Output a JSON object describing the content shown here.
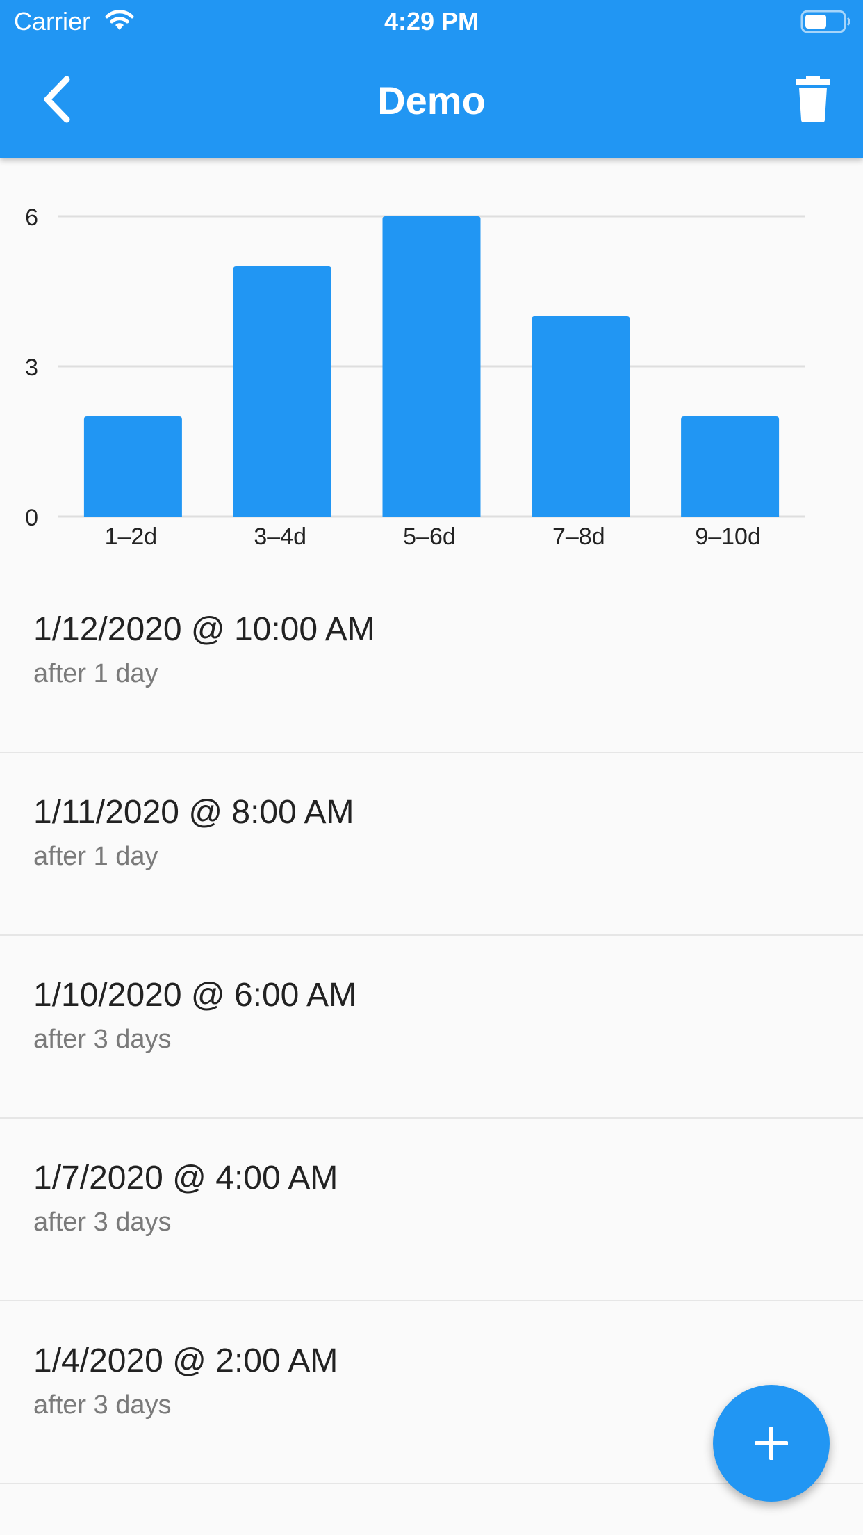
{
  "status_bar": {
    "carrier": "Carrier",
    "time": "4:29 PM"
  },
  "app_bar": {
    "title": "Demo",
    "back_icon": "chevron-left-icon",
    "delete_icon": "trash-icon"
  },
  "colors": {
    "primary": "#2196f3",
    "bar": "#2196f3",
    "background": "#fafafa"
  },
  "chart_data": {
    "type": "bar",
    "categories": [
      "1–2d",
      "3–4d",
      "5–6d",
      "7–8d",
      "9–10d"
    ],
    "values": [
      2,
      5,
      6,
      4,
      2
    ],
    "ylim": [
      0,
      6
    ],
    "yticks": [
      "0",
      "3",
      "6"
    ],
    "grid": true,
    "title": "",
    "xlabel": "",
    "ylabel": ""
  },
  "entries": [
    {
      "datetime": "1/12/2020 @ 10:00 AM",
      "interval": "after 1 day"
    },
    {
      "datetime": "1/11/2020 @ 8:00 AM",
      "interval": "after 1 day"
    },
    {
      "datetime": "1/10/2020 @ 6:00 AM",
      "interval": "after 3 days"
    },
    {
      "datetime": "1/7/2020 @ 4:00 AM",
      "interval": "after 3 days"
    },
    {
      "datetime": "1/4/2020 @ 2:00 AM",
      "interval": "after 3 days"
    }
  ],
  "fab": {
    "icon": "plus-icon"
  }
}
